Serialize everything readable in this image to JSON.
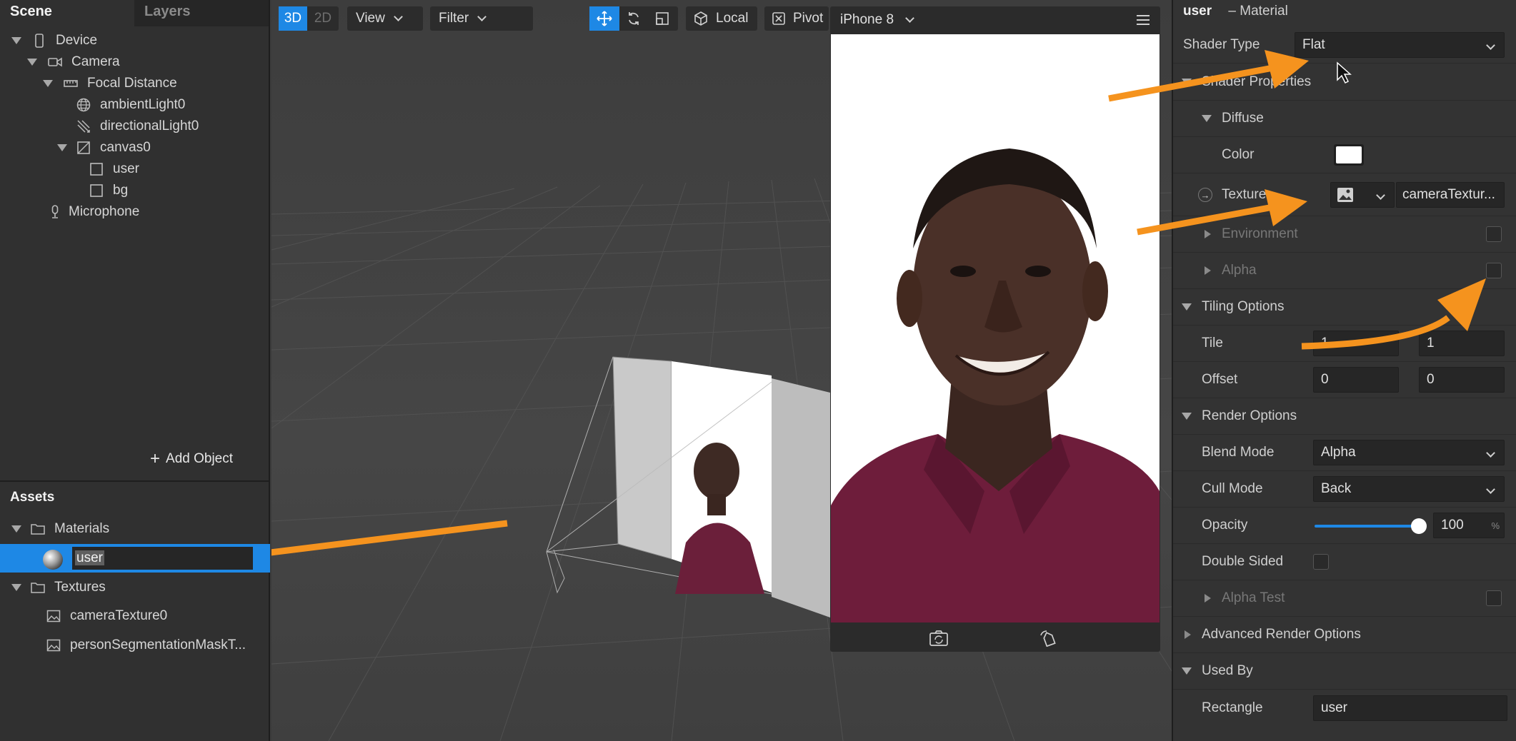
{
  "scene_tabs": [
    "Scene",
    "Layers"
  ],
  "scene_tree": [
    {
      "label": "Device"
    },
    {
      "label": "Camera"
    },
    {
      "label": "Focal Distance"
    },
    {
      "label": "ambientLight0"
    },
    {
      "label": "directionalLight0"
    },
    {
      "label": "canvas0"
    },
    {
      "label": "user"
    },
    {
      "label": "bg"
    },
    {
      "label": "Microphone"
    }
  ],
  "add_object_label": "Add Object",
  "assets": {
    "title": "Assets",
    "materials_label": "Materials",
    "selected_material": "user",
    "textures_label": "Textures",
    "textures": [
      "cameraTexture0",
      "personSegmentationMaskT..."
    ]
  },
  "toolbar": {
    "mode_3d": "3D",
    "mode_2d": "2D",
    "view_label": "View",
    "filter_label": "Filter",
    "local_label": "Local",
    "pivot_label": "Pivot"
  },
  "simulator": {
    "device_label": "iPhone 8"
  },
  "inspector": {
    "object_name": "user",
    "object_type": "– Material",
    "shader_type_label": "Shader Type",
    "shader_type_value": "Flat",
    "shader_properties_label": "Shader Properties",
    "diffuse_label": "Diffuse",
    "color_label": "Color",
    "color_value": "#ffffff",
    "texture_label": "Texture",
    "texture_value": "cameraTextur...",
    "environment_label": "Environment",
    "alpha_label": "Alpha",
    "tiling_label": "Tiling Options",
    "tile_label": "Tile",
    "tile_x": "1",
    "tile_y": "1",
    "offset_label": "Offset",
    "offset_x": "0",
    "offset_y": "0",
    "render_options_label": "Render Options",
    "blend_mode_label": "Blend Mode",
    "blend_mode_value": "Alpha",
    "cull_mode_label": "Cull Mode",
    "cull_mode_value": "Back",
    "opacity_label": "Opacity",
    "opacity_value": "100",
    "opacity_unit": "%",
    "double_sided_label": "Double Sided",
    "alpha_test_label": "Alpha Test",
    "advanced_label": "Advanced Render Options",
    "used_by_label": "Used By",
    "rectangle_label": "Rectangle",
    "rectangle_value": "user"
  },
  "colors": {
    "accent": "#1e88e5",
    "annotation_arrow": "#f5931e"
  }
}
